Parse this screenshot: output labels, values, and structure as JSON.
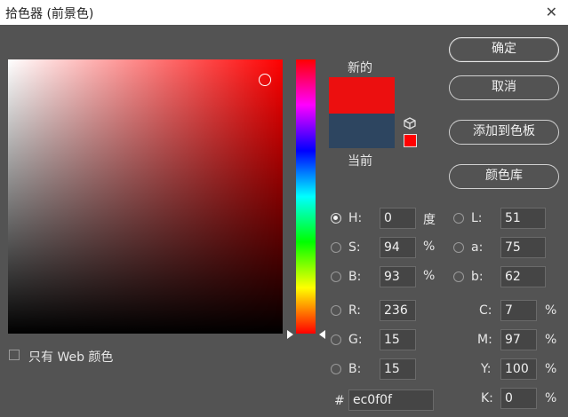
{
  "window": {
    "title": "拾色器 (前景色)",
    "close_icon": "close-icon"
  },
  "labels": {
    "new": "新的",
    "current": "当前",
    "web_only": "只有 Web 颜色"
  },
  "colors": {
    "new": "#ec0f0f",
    "current": "#2d4560",
    "field_hue": "#ff0000"
  },
  "buttons": {
    "ok": "确定",
    "cancel": "取消",
    "add_swatch": "添加到色板",
    "libraries": "颜色库"
  },
  "hsb": {
    "h": {
      "label": "H:",
      "value": "0",
      "unit": "度"
    },
    "s": {
      "label": "S:",
      "value": "94",
      "unit": "%"
    },
    "b": {
      "label": "B:",
      "value": "93",
      "unit": "%"
    }
  },
  "rgb": {
    "r": {
      "label": "R:",
      "value": "236"
    },
    "g": {
      "label": "G:",
      "value": "15"
    },
    "b": {
      "label": "B:",
      "value": "15"
    }
  },
  "lab": {
    "l": {
      "label": "L:",
      "value": "51"
    },
    "a": {
      "label": "a:",
      "value": "75"
    },
    "b": {
      "label": "b:",
      "value": "62"
    }
  },
  "cmyk": {
    "c": {
      "label": "C:",
      "value": "7",
      "unit": "%"
    },
    "m": {
      "label": "M:",
      "value": "97",
      "unit": "%"
    },
    "y": {
      "label": "Y:",
      "value": "100",
      "unit": "%"
    },
    "k": {
      "label": "K:",
      "value": "0",
      "unit": "%"
    }
  },
  "hex": {
    "label": "#",
    "value": "ec0f0f"
  }
}
